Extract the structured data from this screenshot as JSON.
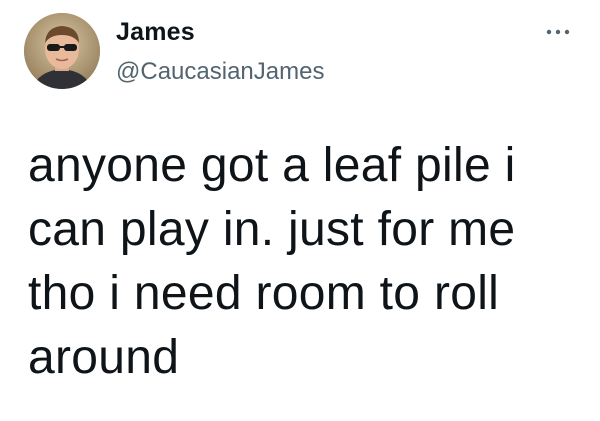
{
  "tweet": {
    "author": {
      "display_name": "James",
      "handle": "@CaucasianJames",
      "avatar_icon": "profile-photo-avatar"
    },
    "more_icon": "more-options-icon",
    "text": "anyone got a leaf pile i\ncan play in. just for me\ntho i need room to roll\naround"
  },
  "colors": {
    "background": "#ffffff",
    "primary_text": "#0f1419",
    "secondary_text": "#536471"
  }
}
